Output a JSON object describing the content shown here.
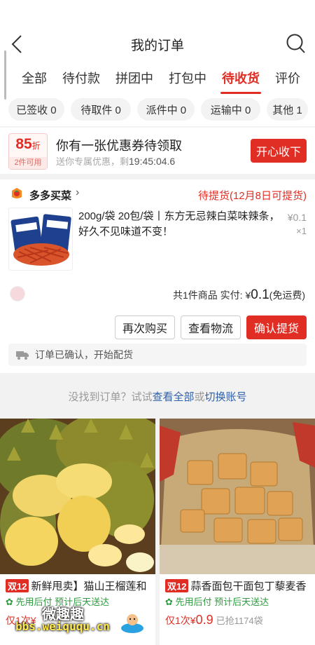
{
  "header": {
    "title": "我的订单"
  },
  "tabs": [
    {
      "label": "全部"
    },
    {
      "label": "待付款"
    },
    {
      "label": "拼团中"
    },
    {
      "label": "打包中"
    },
    {
      "label": "待收货"
    },
    {
      "label": "评价"
    }
  ],
  "subtabs": [
    {
      "label": "已签收 0"
    },
    {
      "label": "待取件 0"
    },
    {
      "label": "派件中 0"
    },
    {
      "label": "运输中 0"
    },
    {
      "label": "其他 1"
    }
  ],
  "coupon": {
    "discount": "85",
    "discount_unit": "折",
    "condition": "2件可用",
    "title": "你有一张优惠券待领取",
    "subtitle": "送你专属优惠，剩",
    "countdown": "19:45:04.6",
    "claim_label": "开心收下"
  },
  "order": {
    "shop_name": "多多买菜",
    "status": "待提货(12月8日可提货)",
    "product_desc": "200g/袋 20包/袋丨东方无忌辣白菜味辣条，好久不见味道不变！",
    "price": "¥0.1",
    "quantity": "×1",
    "summary_count": "共1件商品 实付: ",
    "summary_currency": "¥",
    "summary_amount": "0.1",
    "summary_shipping": "(免运费)",
    "buttons": {
      "rebuy": "再次购买",
      "logistics": "查看物流",
      "confirm": "确认提货"
    },
    "notice": "订单已确认，开始配货"
  },
  "not_found": {
    "prefix": "没找到订单？试试",
    "link_all": "查看全部",
    "or": "或",
    "link_switch": "切换账号"
  },
  "recommendations": [
    {
      "tag": "双12",
      "title": "新鲜甩卖】猫山王榴莲和",
      "feature": "先用后付  预计后天送达",
      "price_prefix": "仅1次",
      "price_currency": "¥",
      "price": "",
      "sold": ""
    },
    {
      "tag": "双12",
      "title": "蒜香面包干面包丁藜麦香",
      "feature": "先用后付  预计后天送达",
      "price_prefix": "仅1次",
      "price_currency": "¥",
      "price": "0.9",
      "sold": "已抢1174袋"
    }
  ],
  "watermark": {
    "line1": "微趣趣",
    "line2": "bbs.weiququ.cn"
  },
  "colors": {
    "accent": "#e02e24",
    "link": "#2f5fa8",
    "green": "#2f9a3f"
  }
}
